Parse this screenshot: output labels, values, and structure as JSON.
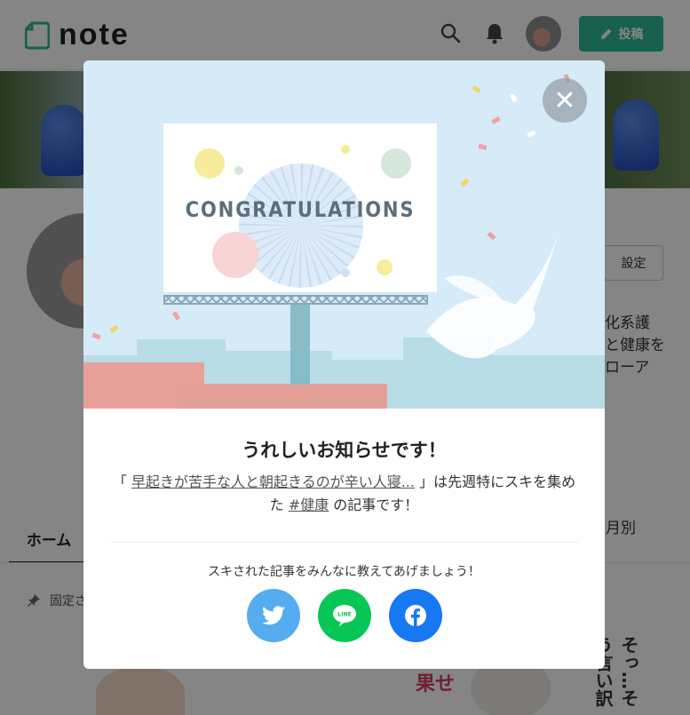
{
  "header": {
    "logo_text": "note",
    "post_label": "投稿",
    "icons": [
      "search-icon",
      "bell-icon",
      "pencil-icon"
    ]
  },
  "profile": {
    "settings_label": "設定",
    "bio_text": "化系護\nと健康を\nローア"
  },
  "tabs": {
    "home": "ホーム",
    "monthly": "月別"
  },
  "pinned": {
    "label": "固定さ"
  },
  "background_cards": {
    "text1": "果せ",
    "text2": "そっ…そう言い訳"
  },
  "modal": {
    "banner_text": "CONGRATULATIONS",
    "title": "うれしいお知らせです！",
    "msg_prefix": "「",
    "article_title": "早起きが苦手な人と朝起きるのが辛い人寝...",
    "msg_middle": "」は先週特にスキを集めた",
    "hashtag": "#健康",
    "msg_suffix": "の記事です！",
    "share_prompt": "スキされた記事をみんなに教えてあげましょう！",
    "close_icon": "close-icon",
    "share": [
      {
        "name": "twitter",
        "icon": "twitter-icon",
        "color": "#55acee"
      },
      {
        "name": "line",
        "icon": "line-icon",
        "color": "#06c755",
        "label": "LINE"
      },
      {
        "name": "facebook",
        "icon": "facebook-icon",
        "color": "#1877f2"
      }
    ]
  },
  "colors": {
    "brand": "#2cb696",
    "overlay": "rgba(0,0,0,0.48)",
    "banner_bg": "#d5ebf7"
  }
}
